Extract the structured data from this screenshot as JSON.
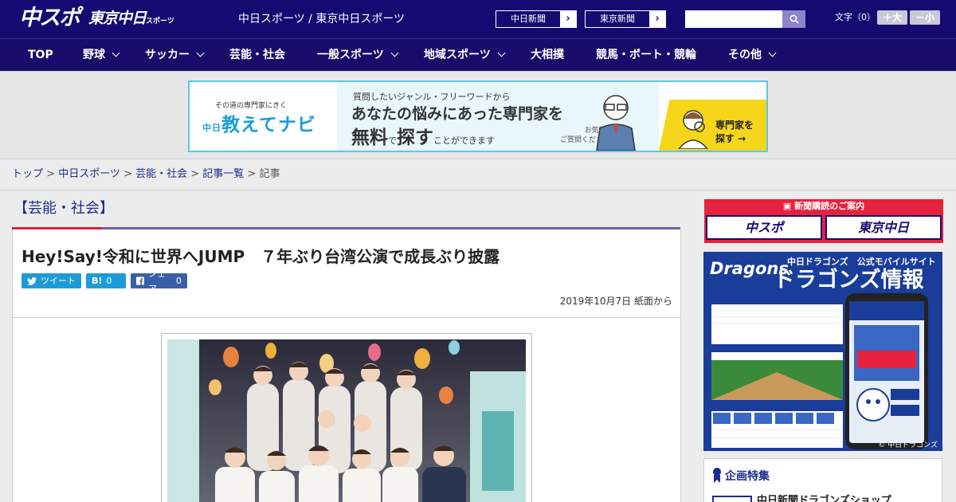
{
  "header": {
    "logo_chunichi_sports": "中スポ",
    "logo_tokyo_chunichi": "東京中日",
    "logo_tokyo_chunichi_small": "スポーツ",
    "site_title": "中日スポーツ / 東京中日スポーツ",
    "chunichi_shimbun_label": "中日新聞",
    "tokyo_shimbun_label": "東京新聞",
    "search_placeholder": "",
    "font_size_label": "文字（0）",
    "font_larger_label": "＋大",
    "font_smaller_label": "－小"
  },
  "nav": {
    "items": [
      {
        "label": "TOP",
        "has_dropdown": false
      },
      {
        "label": "野球",
        "has_dropdown": true
      },
      {
        "label": "サッカー",
        "has_dropdown": true
      },
      {
        "label": "芸能・社会",
        "has_dropdown": false
      },
      {
        "label": "一般スポーツ",
        "has_dropdown": true
      },
      {
        "label": "地域スポーツ",
        "has_dropdown": true
      },
      {
        "label": "大相撲",
        "has_dropdown": false
      },
      {
        "label": "競馬・ボート・競輪",
        "has_dropdown": false
      },
      {
        "label": "その他",
        "has_dropdown": true
      }
    ]
  },
  "ad_banner": {
    "small_text": "その道の専門家にきく",
    "brand": "教えてナビ",
    "brand_prefix": "中日",
    "line1": "質問したいジャンル・フリーワードから",
    "line2": "あなたの悩みにあった専門家を",
    "line3_a": "無料",
    "line3_b": "で",
    "line3_c": "探す",
    "line3_d": "ことができます",
    "aside": "お気軽に\nご質問ください!",
    "cta": "専門家を\n探す →"
  },
  "breadcrumb": {
    "items": [
      "トップ",
      "中日スポーツ",
      "芸能・社会",
      "記事一覧"
    ],
    "current": "記事",
    "separator": " > "
  },
  "category": {
    "title": "【芸能・社会】"
  },
  "article": {
    "headline": "Hey!Say!令和に世界へJUMP　７年ぶり台湾公演で成長ぶり披露",
    "tweet_label": "ツイート",
    "hatena_label": "B!",
    "hatena_count": "0",
    "facebook_label": "シェア",
    "facebook_count": "0",
    "dateline": "2019年10月7日 紙面から"
  },
  "sidebar": {
    "subscription_title": "新聞購読のご案内",
    "sub_btn1": "中スポ",
    "sub_btn2": "東京中日",
    "dragons": {
      "logo": "Dragons",
      "subtitle": "中日ドラゴンズ　公式モバイルサイト",
      "title": "ドラゴンズ情報",
      "copyright": "© 中日ドラゴンズ"
    },
    "feature_title": "企画特集",
    "feature_item": "中日新聞ドラゴンズショップ"
  },
  "colors": {
    "header_bg": "#150a72",
    "nav_bg": "#180c6a",
    "accent_red": "#d8243b",
    "accent_purple": "#6e5dae",
    "link_blue": "#1a2c8c",
    "twitter": "#1d9bd9",
    "facebook": "#3b5ea8"
  }
}
